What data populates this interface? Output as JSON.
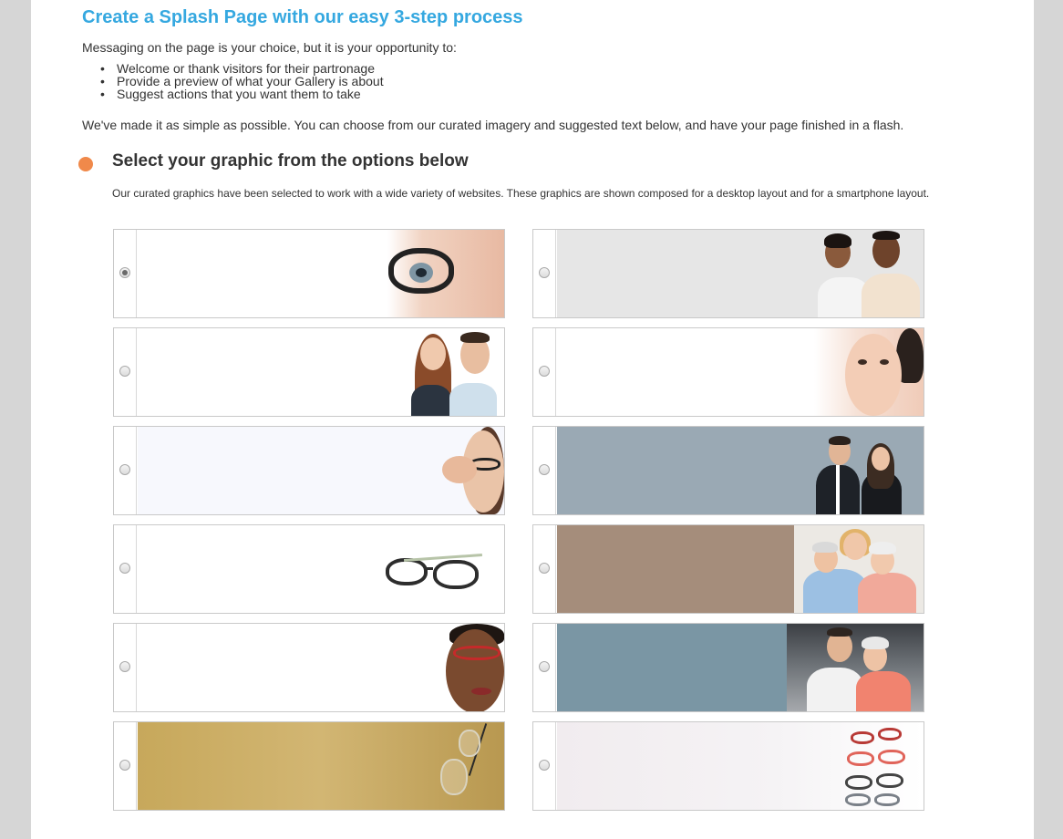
{
  "header": {
    "title": "Create a Splash Page with our easy 3-step process",
    "intro": "Messaging on the page is your choice, but it is your opportunity to:",
    "bullets": [
      "Welcome or thank visitors for their partronage",
      "Provide a preview of what your Gallery is about",
      "Suggest actions that you want them to take"
    ],
    "simple_text": "We've made it as simple as possible. You can choose from our curated imagery and suggested text below, and have your page finished in a flash."
  },
  "step": {
    "heading": "Select your graphic from the options below",
    "description": "Our curated graphics have been selected to work with a wide variety of websites. These graphics are shown composed for a desktop layout and for a smartphone layout."
  },
  "colors": {
    "title": "#35a8e0",
    "step_dot": "#f0894a",
    "page_background": "#d6d6d6"
  },
  "graphic_options": [
    {
      "id": "eye-glasses-closeup",
      "selected": true,
      "subject": "woman eye with black glasses",
      "bg": "#ffffff"
    },
    {
      "id": "smiling-couple",
      "selected": false,
      "subject": "smiling couple",
      "bg": "#e6e6e6"
    },
    {
      "id": "couple-with-glasses",
      "selected": false,
      "subject": "man and woman with glasses",
      "bg": "#ffffff"
    },
    {
      "id": "woman-face-portrait",
      "selected": false,
      "subject": "woman face",
      "bg": "#ffffff"
    },
    {
      "id": "woman-adjusting-glasses",
      "selected": false,
      "subject": "woman adjusting glasses",
      "bg": "#f7f8fd"
    },
    {
      "id": "business-couple",
      "selected": false,
      "subject": "couple in business attire",
      "bg": "#9aa9b4"
    },
    {
      "id": "eyeglasses-product",
      "selected": false,
      "subject": "eyeglasses",
      "bg": "#ffffff"
    },
    {
      "id": "senior-women-family",
      "selected": false,
      "subject": "senior women hugging",
      "bg": "#a58d7b"
    },
    {
      "id": "woman-red-glasses",
      "selected": false,
      "subject": "woman with red glasses",
      "bg": "#ffffff"
    },
    {
      "id": "senior-couple-hug",
      "selected": false,
      "subject": "senior couple hugging",
      "bg": "#7a96a4"
    },
    {
      "id": "gold-glasses-chain",
      "selected": false,
      "subject": "glasses on chain",
      "bg": "#c8aa5e"
    },
    {
      "id": "stacked-eyeglasses",
      "selected": false,
      "subject": "stack of eyeglasses",
      "bg": "#f1ecef"
    }
  ]
}
